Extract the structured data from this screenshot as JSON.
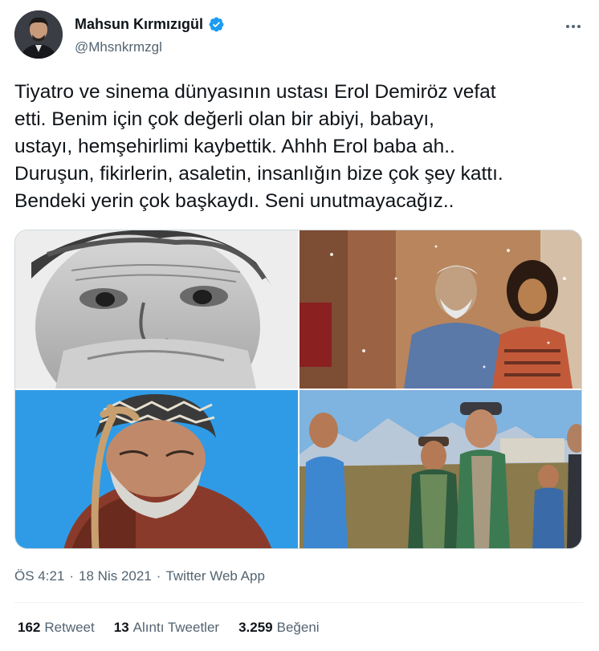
{
  "author": {
    "name": "Mahsun Kırmızıgül",
    "handle": "@Mhsnkrmzgl",
    "verified_color": "#1d9bf0"
  },
  "tweet": {
    "lines": [
      "Tiyatro ve sinema dünyasının ustası Erol Demiröz vefat",
      "etti.   Benim için çok değerli olan bir abiyi, babayı,",
      "ustayı,  hemşehirlimi kaybettik.  Ahhh Erol baba ah..",
      "Duruşun, fikirlerin, asaletin, insanlığın bize çok şey kattı.",
      "Bendeki yerin çok başkaydı.  Seni unutmayacağız.."
    ]
  },
  "media": {
    "photos": [
      {
        "icon": "portrait-photo-bw"
      },
      {
        "icon": "film-still-snow"
      },
      {
        "icon": "portrait-photo-elder"
      },
      {
        "icon": "film-still-village"
      }
    ]
  },
  "meta": {
    "time": "ÖS 4:21",
    "sep1": "·",
    "date": "18 Nis 2021",
    "sep2": "·",
    "source": "Twitter Web App"
  },
  "stats": {
    "retweets": {
      "count": "162",
      "label": "Retweet"
    },
    "quotes": {
      "count": "13",
      "label": "Alıntı Tweetler"
    },
    "likes": {
      "count": "3.259",
      "label": "Beğeni"
    }
  }
}
